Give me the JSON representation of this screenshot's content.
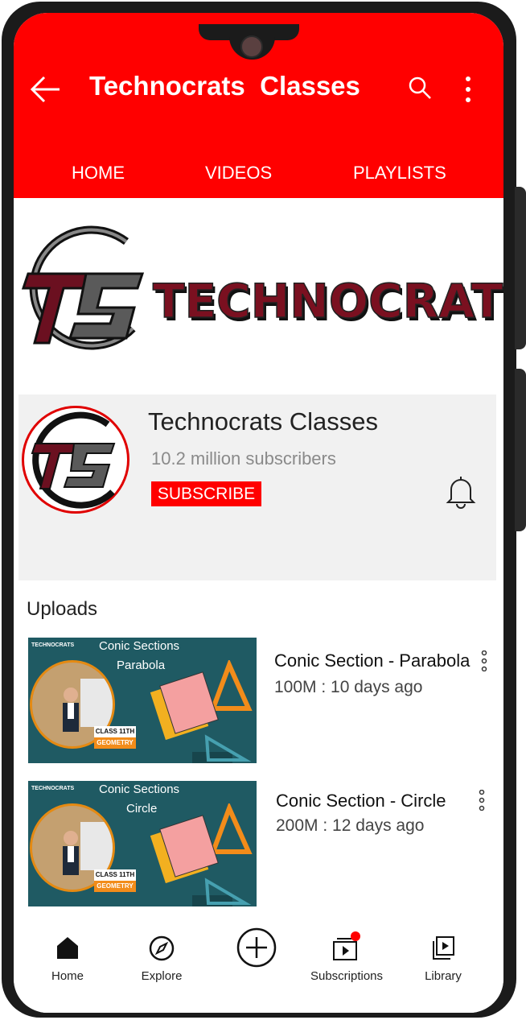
{
  "header": {
    "title": "Technocrats  Classes",
    "tabs": [
      "HOME",
      "VIDEOS",
      "PLAYLISTS"
    ]
  },
  "banner": {
    "logo_text": "TECHNOCRATS",
    "monogram": "TC"
  },
  "channel": {
    "name": "Technocrats Classes",
    "subscribers": "10.2 million subscribers",
    "subscribe_label": "SUBSCRIBE"
  },
  "uploads": {
    "heading": "Uploads",
    "videos": [
      {
        "title": "Conic Section - Parabola",
        "meta": "100M : 10 days ago",
        "thumb_title": "Conic Sections",
        "thumb_subtitle": "Parabola",
        "thumb_brand": "TECHNOCRATS",
        "class_label": "CLASS 11TH",
        "subject_label": "GEOMETRY"
      },
      {
        "title": "Conic Section - Circle",
        "meta": "200M : 12 days ago",
        "thumb_title": "Conic Sections",
        "thumb_subtitle": "Circle",
        "thumb_brand": "TECHNOCRATS",
        "class_label": "CLASS 11TH",
        "subject_label": "GEOMETRY"
      }
    ]
  },
  "nav": {
    "home": "Home",
    "explore": "Explore",
    "subscriptions": "Subscriptions",
    "library": "Library"
  },
  "colors": {
    "brand_red": "#ff0000",
    "thumb_teal": "#1f5a63",
    "accent_orange": "#f28c1a"
  }
}
